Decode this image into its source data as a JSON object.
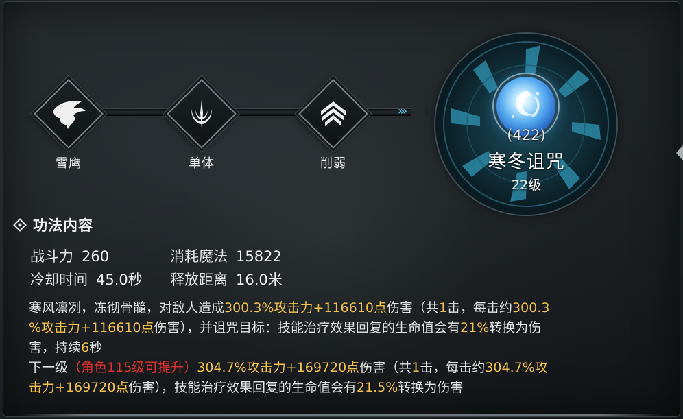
{
  "chain": {
    "nodes": [
      {
        "label": "雪鹰",
        "icon": "eagle-icon"
      },
      {
        "label": "单体",
        "icon": "single-target-icon"
      },
      {
        "label": "削弱",
        "icon": "debuff-chevron-icon"
      }
    ],
    "arrow": "›››"
  },
  "skill": {
    "count": "(422)",
    "name": "寒冬诅咒",
    "level": "22级",
    "icon": "winter-curse-orb-icon"
  },
  "section": {
    "title": "功法内容",
    "bullet_icon": "diamond-bullet-icon"
  },
  "stats": {
    "power_label": "战斗力",
    "power_value": "260",
    "mana_label": "消耗魔法",
    "mana_value": "15822",
    "cooldown_label": "冷却时间",
    "cooldown_value": "45.0秒",
    "range_label": "释放距离",
    "range_value": "16.0米"
  },
  "description": {
    "l1a": "寒风凛冽，冻彻骨髓，对敌人造成",
    "l1b": "300.3%攻击力+116610点",
    "l1c": "伤害（共",
    "l1d": "1",
    "l1e": "击，每击约",
    "l1f": "300.3",
    "l2a": "%攻击力+116610点",
    "l2b": "伤害），并诅咒目标：技能治疗效果回复的生命值会有",
    "l2c": "21%",
    "l2d": "转换为伤",
    "l3a": "害，持续",
    "l3b": "6",
    "l3c": "秒"
  },
  "next_level": {
    "l1a": "下一级",
    "l1b": "（角色115级可提升）",
    "l1c": "304.7%攻击力+169720点",
    "l1d": "伤害（共",
    "l1e": "1",
    "l1f": "击，每击约",
    "l1g": "304.7%攻",
    "l2a": "击力+169720点",
    "l2b": "伤害），技能治疗效果回复的生命值会有",
    "l2c": "21.5%",
    "l2d": "转换为伤害"
  },
  "colors": {
    "highlight": "#f2c14a",
    "requirement": "#e0322d",
    "accent": "#5bc3e6"
  }
}
